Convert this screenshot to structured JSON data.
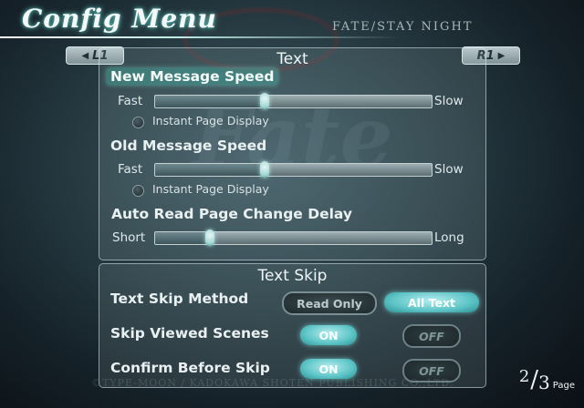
{
  "header": {
    "title": "Config Menu",
    "game_title": "FATE/STAY NIGHT"
  },
  "nav": {
    "prev_label": "L1",
    "prev_icon": "left-arrow-icon",
    "next_label": "R1",
    "next_icon": "right-arrow-icon"
  },
  "text_panel": {
    "title": "Text",
    "new_speed": {
      "label": "New Message Speed",
      "min_label": "Fast",
      "max_label": "Slow",
      "value_fraction": 0.4,
      "instant_label": "Instant Page Display"
    },
    "old_speed": {
      "label": "Old Message Speed",
      "min_label": "Fast",
      "max_label": "Slow",
      "value_fraction": 0.4,
      "instant_label": "Instant Page Display"
    },
    "auto_delay": {
      "label": "Auto Read Page Change Delay",
      "min_label": "Short",
      "max_label": "Long",
      "value_fraction": 0.2
    }
  },
  "skip_panel": {
    "title": "Text Skip",
    "method": {
      "label": "Text Skip Method",
      "options": [
        "Read Only",
        "All Text"
      ],
      "selected": "All Text"
    },
    "viewed": {
      "label": "Skip Viewed Scenes",
      "on_label": "ON",
      "off_label": "OFF",
      "selected": "ON"
    },
    "confirm": {
      "label": "Confirm Before Skip",
      "on_label": "ON",
      "off_label": "OFF",
      "selected": "ON"
    }
  },
  "page": {
    "current": "2",
    "total": "3",
    "word": "Page"
  },
  "footer": {
    "copyright": "©TYPE-MOON / KADOKAWA SHOTEN PUBLISHING CO.,LTD."
  },
  "colors": {
    "accent": "#5cc4c6",
    "highlight": "#46a096",
    "panel_border": "#dcebee"
  }
}
